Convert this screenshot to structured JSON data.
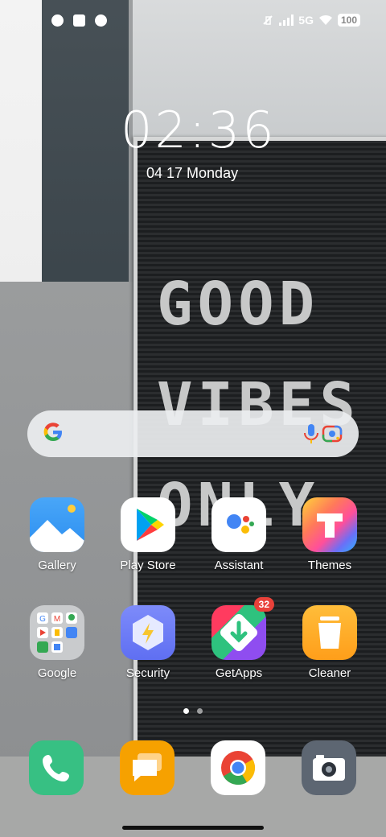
{
  "status": {
    "network": "5G",
    "battery": "100"
  },
  "lockscreen": {
    "time": "02:36",
    "date": "04 17 Monday"
  },
  "wallpaper": {
    "words": [
      "GOOD",
      "VIBES",
      "ONLY"
    ]
  },
  "search": {
    "icons": [
      "google-g-icon",
      "microphone-icon",
      "google-lens-icon"
    ]
  },
  "apps_row1": [
    {
      "label": "Gallery",
      "icon": "gallery-icon"
    },
    {
      "label": "Play Store",
      "icon": "play-store-icon"
    },
    {
      "label": "Assistant",
      "icon": "assistant-icon"
    },
    {
      "label": "Themes",
      "icon": "themes-icon"
    }
  ],
  "apps_row2": [
    {
      "label": "Google",
      "icon": "google-folder-icon"
    },
    {
      "label": "Security",
      "icon": "security-icon"
    },
    {
      "label": "GetApps",
      "icon": "getapps-icon",
      "badge": "32"
    },
    {
      "label": "Cleaner",
      "icon": "cleaner-icon"
    }
  ],
  "pager": {
    "pages": 2,
    "active": 1
  },
  "dock": [
    {
      "icon": "phone-icon"
    },
    {
      "icon": "messages-icon"
    },
    {
      "icon": "chrome-icon"
    },
    {
      "icon": "camera-icon"
    }
  ],
  "colors": {
    "accent_red": "#e9413a",
    "phone_green": "#37c083",
    "messages_orange": "#f6a100"
  }
}
